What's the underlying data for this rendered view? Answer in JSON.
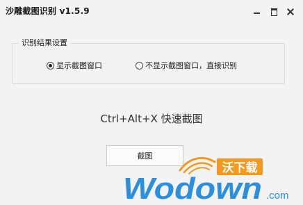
{
  "window": {
    "title": "沙雕截图识别  v1.5.9",
    "controls": {
      "minimize": "minimize-icon",
      "maximize": "maximize-icon",
      "close": "close-icon"
    }
  },
  "result_settings": {
    "group_title": "识别结果设置",
    "options": [
      {
        "label": "显示截图窗口",
        "checked": true
      },
      {
        "label": "不显示截图窗口，直接识别",
        "checked": false
      }
    ]
  },
  "hotkey_text": "Ctrl+Alt+X 快速截图",
  "capture_button": "截图",
  "watermark": {
    "brand_cn": "沃下载",
    "brand_en": "Wodown",
    "suffix": ".com"
  },
  "colors": {
    "background": "#f3f3f3",
    "watermark_blue": "#2b8fe0",
    "watermark_orange": "#f39a1e"
  }
}
